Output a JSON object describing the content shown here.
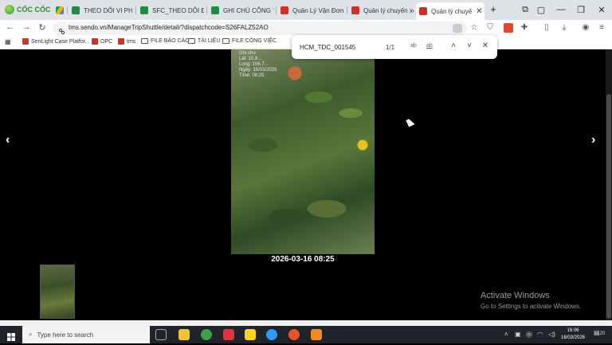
{
  "browser": {
    "logo_text": "CỐC CỐC",
    "tabs": [
      {
        "label": "",
        "icon": "google-drive-icon"
      },
      {
        "label": "THEO DÕI VI PHẠM",
        "icon": "sheets-icon"
      },
      {
        "label": "SFC_THEO DÕI ĐỐI",
        "icon": "sheets-icon"
      },
      {
        "label": "GHI CHÚ CÔNG VIỆ",
        "icon": "sheets-icon"
      },
      {
        "label": "Quản Lý Vận Đơn C",
        "icon": "sendo-icon"
      },
      {
        "label": "Quản lý chuyến xe",
        "icon": "sendo-icon"
      },
      {
        "label": "Quản lý chuyế",
        "icon": "sendo-icon",
        "active": true
      }
    ],
    "url": "tms.sendo.vn/ManageTripShuttle/detail/?dispatchcode=S26FALZ52AO",
    "bookmarks": [
      {
        "label": "SenLight Case Platfor...",
        "type": "site"
      },
      {
        "label": "OPC",
        "type": "site"
      },
      {
        "label": "tms",
        "type": "site"
      },
      {
        "label": "FILE BÁO CÁO",
        "type": "folder"
      },
      {
        "label": "TÀI LIỆU",
        "type": "folder"
      },
      {
        "label": "FILE CÔNG VIỆC",
        "type": "folder"
      }
    ]
  },
  "find": {
    "query": "HCM_TDC_001545",
    "count": "1/1",
    "match_case": "ab",
    "whole_word": "ab"
  },
  "viewer": {
    "prev": "‹",
    "next": "›",
    "timestamp": "2026-03-16 08:25",
    "photo_stamp": [
      "Ghi chú",
      "Lat: 10.8...",
      "Long: 106.7...",
      "Ngày: 16/03/2026",
      "Time: 08:25"
    ]
  },
  "activation": {
    "title": "Activate Windows",
    "subtitle": "Go to Settings to activate Windows."
  },
  "taskbar": {
    "search_placeholder": "Type here to search",
    "time": "16:06",
    "date": "16/03/2026",
    "notifications": "20"
  }
}
